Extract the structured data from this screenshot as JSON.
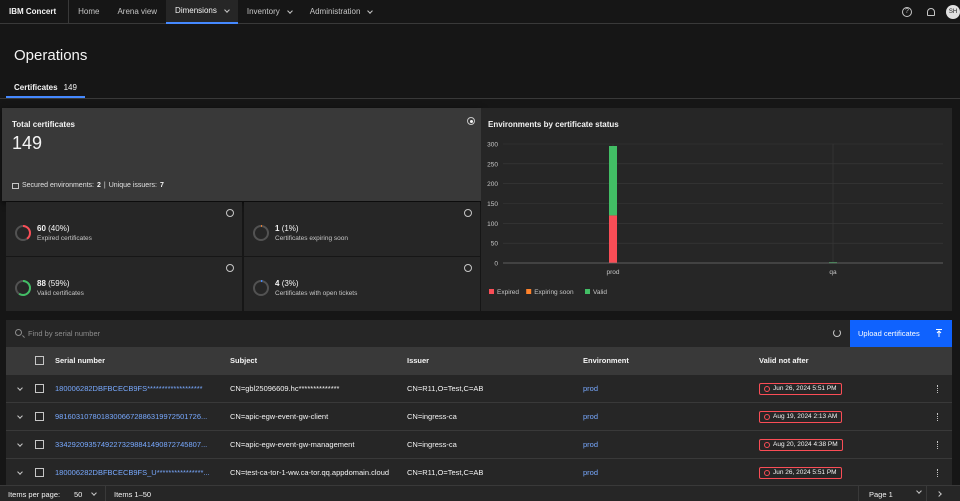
{
  "header": {
    "brand": "IBM Concert",
    "nav": [
      {
        "label": "Home",
        "active": false,
        "dropdown": false
      },
      {
        "label": "Arena view",
        "active": false,
        "dropdown": false
      },
      {
        "label": "Dimensions",
        "active": true,
        "dropdown": true
      },
      {
        "label": "Inventory",
        "active": false,
        "dropdown": true
      },
      {
        "label": "Administration",
        "active": false,
        "dropdown": true
      }
    ],
    "help_glyph": "?",
    "avatar_initials": "SH"
  },
  "page": {
    "title": "Operations",
    "tab_label": "Certificates",
    "tab_count": "149"
  },
  "summary": {
    "title": "Total certificates",
    "value": "149",
    "secured_label": "Secured environments:",
    "secured_value": "2",
    "issuers_label": "Unique issuers:",
    "issuers_value": "7",
    "separator": "|"
  },
  "stats": [
    {
      "value": "60",
      "pct": "(40%)",
      "label": "Expired certificates",
      "fraction": 0.4,
      "color": "#fa4d56"
    },
    {
      "value": "1",
      "pct": "(1%)",
      "label": "Certificates expiring soon",
      "fraction": 0.01,
      "color": "#ff832b"
    },
    {
      "value": "88",
      "pct": "(59%)",
      "label": "Valid certificates",
      "fraction": 0.59,
      "color": "#42be65"
    },
    {
      "value": "4",
      "pct": "(3%)",
      "label": "Certificates with open tickets",
      "fraction": 0.03,
      "color": "#4589ff"
    }
  ],
  "chart_data": {
    "type": "bar",
    "stacked": true,
    "title": "Environments by certificate status",
    "categories": [
      "prod",
      "qa"
    ],
    "series": [
      {
        "name": "Expired",
        "color": "#fa4d56",
        "values": [
          120,
          0
        ]
      },
      {
        "name": "Expiring soon",
        "color": "#ff832b",
        "values": [
          0,
          0
        ]
      },
      {
        "name": "Valid",
        "color": "#42be65",
        "values": [
          175,
          2
        ]
      }
    ],
    "yticks": [
      "0",
      "50",
      "100",
      "150",
      "200",
      "250",
      "300"
    ],
    "ylim": [
      0,
      300
    ],
    "grid": true,
    "legend": "bottom-left"
  },
  "table": {
    "search_placeholder": "Find by serial number",
    "upload_label": "Upload certificates",
    "columns": [
      "Serial number",
      "Subject",
      "Issuer",
      "Environment",
      "Valid not after"
    ],
    "rows": [
      {
        "serial": "180006282DBFBCECB9FS*******************",
        "subject": "CN=gbl25096609.hc**************",
        "issuer": "CN=R11,O=Test,C=AB",
        "env": "prod",
        "date": "Jun 26, 2024 5:51 PM"
      },
      {
        "serial": "98160310780183006672886319972501726...",
        "subject": "CN=apic-egw-event-gw-client",
        "issuer": "CN=ingress-ca",
        "env": "prod",
        "date": "Aug 19, 2024 2:13 AM"
      },
      {
        "serial": "33429209357492273298841490872745807...",
        "subject": "CN=apic-egw-event-gw-management",
        "issuer": "CN=ingress-ca",
        "env": "prod",
        "date": "Aug 20, 2024 4:38 PM"
      },
      {
        "serial": "180006282DBFBCECB9FS_U****************...",
        "subject": "CN=test-ca-tor-1-ww.ca-tor.qq.appdomain.cloud",
        "issuer": "CN=R11,O=Test,C=AB",
        "env": "prod",
        "date": "Jun 26, 2024 5:51 PM"
      }
    ]
  },
  "pagination": {
    "items_per_page_label": "Items per page:",
    "items_per_page": "50",
    "range": "Items 1–50",
    "page": "Page 1"
  }
}
